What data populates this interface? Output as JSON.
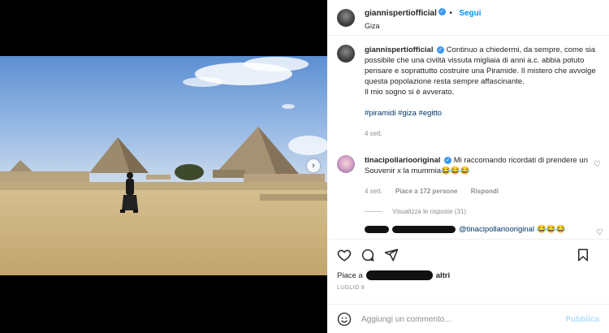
{
  "post": {
    "username": "giannispertiofficial",
    "follow_label": "Segui",
    "location": "Giza",
    "caption": "Continuo a chiedermi, da sempre, come sia possibile che una civiltà vissuta migliaia di anni a.c. abbia potuto pensare e soprattutto costruire una Piramide. Il mistero che avvolge questa popolazione resta sempre affascinante.",
    "caption_line2": "Il mio sogno si è avverato.",
    "hashtags": "#piramidi #giza #egitto",
    "caption_age": "4 sett.",
    "carousel_dots": 9,
    "carousel_active": 0
  },
  "comment": {
    "username": "tinacipollariooriginal",
    "text": "Mi raccomando ricordati di prendere un Souvenir x la mummia😂😂😂",
    "age": "4 sett.",
    "likes": "Piace a 172 persone",
    "reply_label": "Rispondi",
    "view_replies": "Visualizza le risposte (31)"
  },
  "reply": {
    "mention": "@tinacipollariooriginal",
    "text": "😂😂😂"
  },
  "actions": {
    "likes_prefix": "Piace a",
    "likes_suffix": "altri",
    "date": "LUGLIO 8"
  },
  "composer": {
    "placeholder": "Aggiungi un commento...",
    "publish_label": "Pubblica"
  },
  "colors": {
    "accent": "#0095f6",
    "verified": "#3897f0",
    "hashtag": "#00376b"
  }
}
